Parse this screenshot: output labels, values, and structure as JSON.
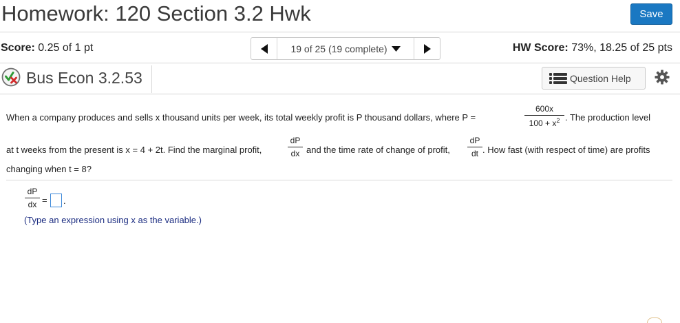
{
  "header": {
    "title": "Homework: 120 Section 3.2 Hwk",
    "save_label": "Save"
  },
  "score": {
    "label": "Score:",
    "value": "0.25 of 1 pt",
    "hw_label": "HW Score:",
    "hw_value": "73%, 18.25 of 25 pts"
  },
  "nav": {
    "position_text": "19 of 25 (19 complete)"
  },
  "problem": {
    "name": "Bus Econ 3.2.53",
    "status_icon": "partial-correct-icon",
    "question_help_label": "Question Help",
    "settings_icon": "gear-icon"
  },
  "question": {
    "line1_a": "When a company produces and sells x thousand units per week, its total weekly profit is P thousand dollars, where P =",
    "p_num": "600x",
    "p_den": "100 + x",
    "p_den_exp": "2",
    "line1_b": ". The production level",
    "line2_a": "at t weeks from the present is x = 4 + 2t. Find the marginal profit,",
    "dpdx_num": "dP",
    "dpdx_den": "dx",
    "line2_b": "and the time rate of change of profit,",
    "dpdt_num": "dP",
    "dpdt_den": "dt",
    "line2_c": ". How fast (with respect of time) are profits",
    "line3": "changing when t = 8?"
  },
  "answer": {
    "lhs_num": "dP",
    "lhs_den": "dx",
    "equals": "=",
    "period": ".",
    "hint": "(Type an expression using x as the variable.)"
  }
}
